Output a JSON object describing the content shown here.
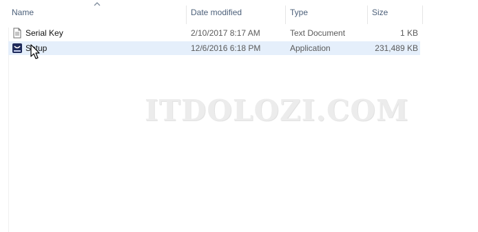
{
  "columns": {
    "name": "Name",
    "date_modified": "Date modified",
    "type": "Type",
    "size": "Size"
  },
  "sort": {
    "column": "name",
    "direction": "ascending",
    "indicator_icon": "chevron-up-icon"
  },
  "files": [
    {
      "name": "Serial Key",
      "date_modified": "2/10/2017 8:17 AM",
      "type": "Text Document",
      "size": "1 KB",
      "icon": "text-document-icon",
      "selected": false
    },
    {
      "name": "Setup",
      "date_modified": "12/6/2016 6:18 PM",
      "type": "Application",
      "size": "231,489 KB",
      "icon": "setup-application-icon",
      "selected": true
    }
  ],
  "watermark": "ITDOLOZI.COM",
  "colors": {
    "header_text": "#4c607a",
    "selection": "#e5effb",
    "meta_text": "#5a5a5a"
  }
}
